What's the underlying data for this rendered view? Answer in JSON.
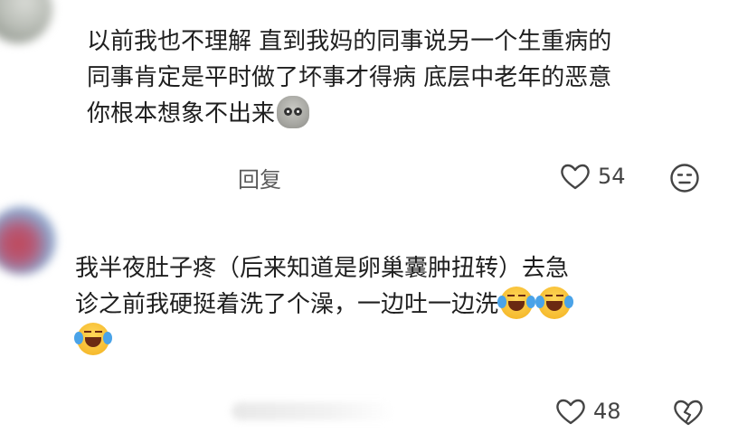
{
  "comments": [
    {
      "lines": [
        "以前我也不理解 直到我妈的同事说另一个生重病的",
        "同事肯定是平时做了坏事才得病 底层中老年的恶意",
        "你根本想象不出来"
      ],
      "trailing_emoji": "ghost-emoji",
      "reply_label": "回复",
      "like_count": "54"
    },
    {
      "lines": [
        "我半夜肚子疼（后来知道是卵巢囊肿扭转）去急",
        "诊之前我硬挺着洗了个澡，一边吐一边洗",
        ""
      ],
      "trailing_emoji": "laughing-crying-emoji",
      "like_count": "48"
    }
  ],
  "icons": {
    "like": "heart-outline-icon",
    "dislike": "neutral-face-icon",
    "dislike2": "broken-heart-icon"
  },
  "colors": {
    "text": "#1f1f1f",
    "secondary_text": "#5a5a5a",
    "icon": "#444444",
    "background": "#ffffff"
  }
}
